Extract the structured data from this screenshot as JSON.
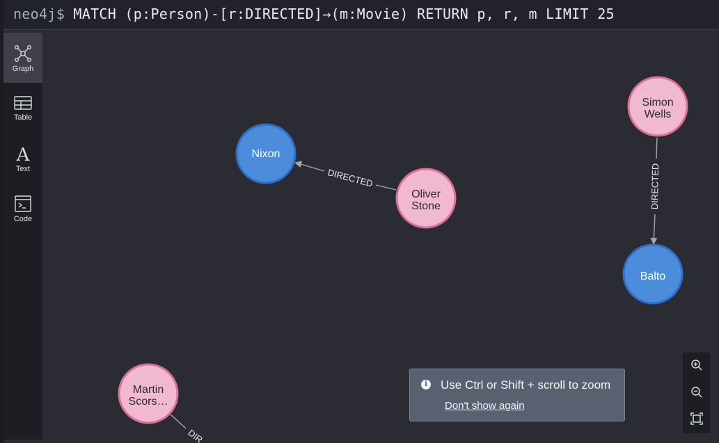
{
  "query": {
    "prompt": "neo4j$",
    "text": "MATCH (p:Person)-[r:DIRECTED]→(m:Movie) RETURN p, r, m LIMIT 25"
  },
  "sidebar": {
    "items": [
      {
        "label": "Graph",
        "icon": "graph-icon",
        "active": true
      },
      {
        "label": "Table",
        "icon": "table-icon",
        "active": false
      },
      {
        "label": "Text",
        "icon": "text-icon",
        "active": false
      },
      {
        "label": "Code",
        "icon": "code-icon",
        "active": false
      }
    ]
  },
  "graph": {
    "nodes": [
      {
        "id": "nixon",
        "label": "Nixon",
        "type": "Movie"
      },
      {
        "id": "oliver",
        "label_lines": [
          "Oliver",
          "Stone"
        ],
        "type": "Person"
      },
      {
        "id": "simon",
        "label_lines": [
          "Simon",
          "Wells"
        ],
        "type": "Person"
      },
      {
        "id": "balto",
        "label": "Balto",
        "type": "Movie"
      },
      {
        "id": "martin",
        "label_lines": [
          "Martin",
          "Scors…"
        ],
        "type": "Person"
      }
    ],
    "relationships": [
      {
        "from": "oliver",
        "to": "nixon",
        "label": "DIRECTED"
      },
      {
        "from": "simon",
        "to": "balto",
        "label": "DIRECTED"
      },
      {
        "from": "martin",
        "to": "offscreen",
        "label": "DIR"
      }
    ],
    "colors": {
      "person_fill": "#f0b9cf",
      "person_stroke": "#d9709a",
      "movie_fill": "#4c8ddb",
      "movie_stroke": "#2f6ec4",
      "edge": "#a5a9b2",
      "background": "#2b2c33"
    }
  },
  "tooltip": {
    "message": "Use Ctrl or Shift + scroll to zoom",
    "dismiss_label": "Don't show again"
  },
  "zoom_controls": [
    "zoom-in-icon",
    "zoom-out-icon",
    "fit-to-screen-icon"
  ]
}
